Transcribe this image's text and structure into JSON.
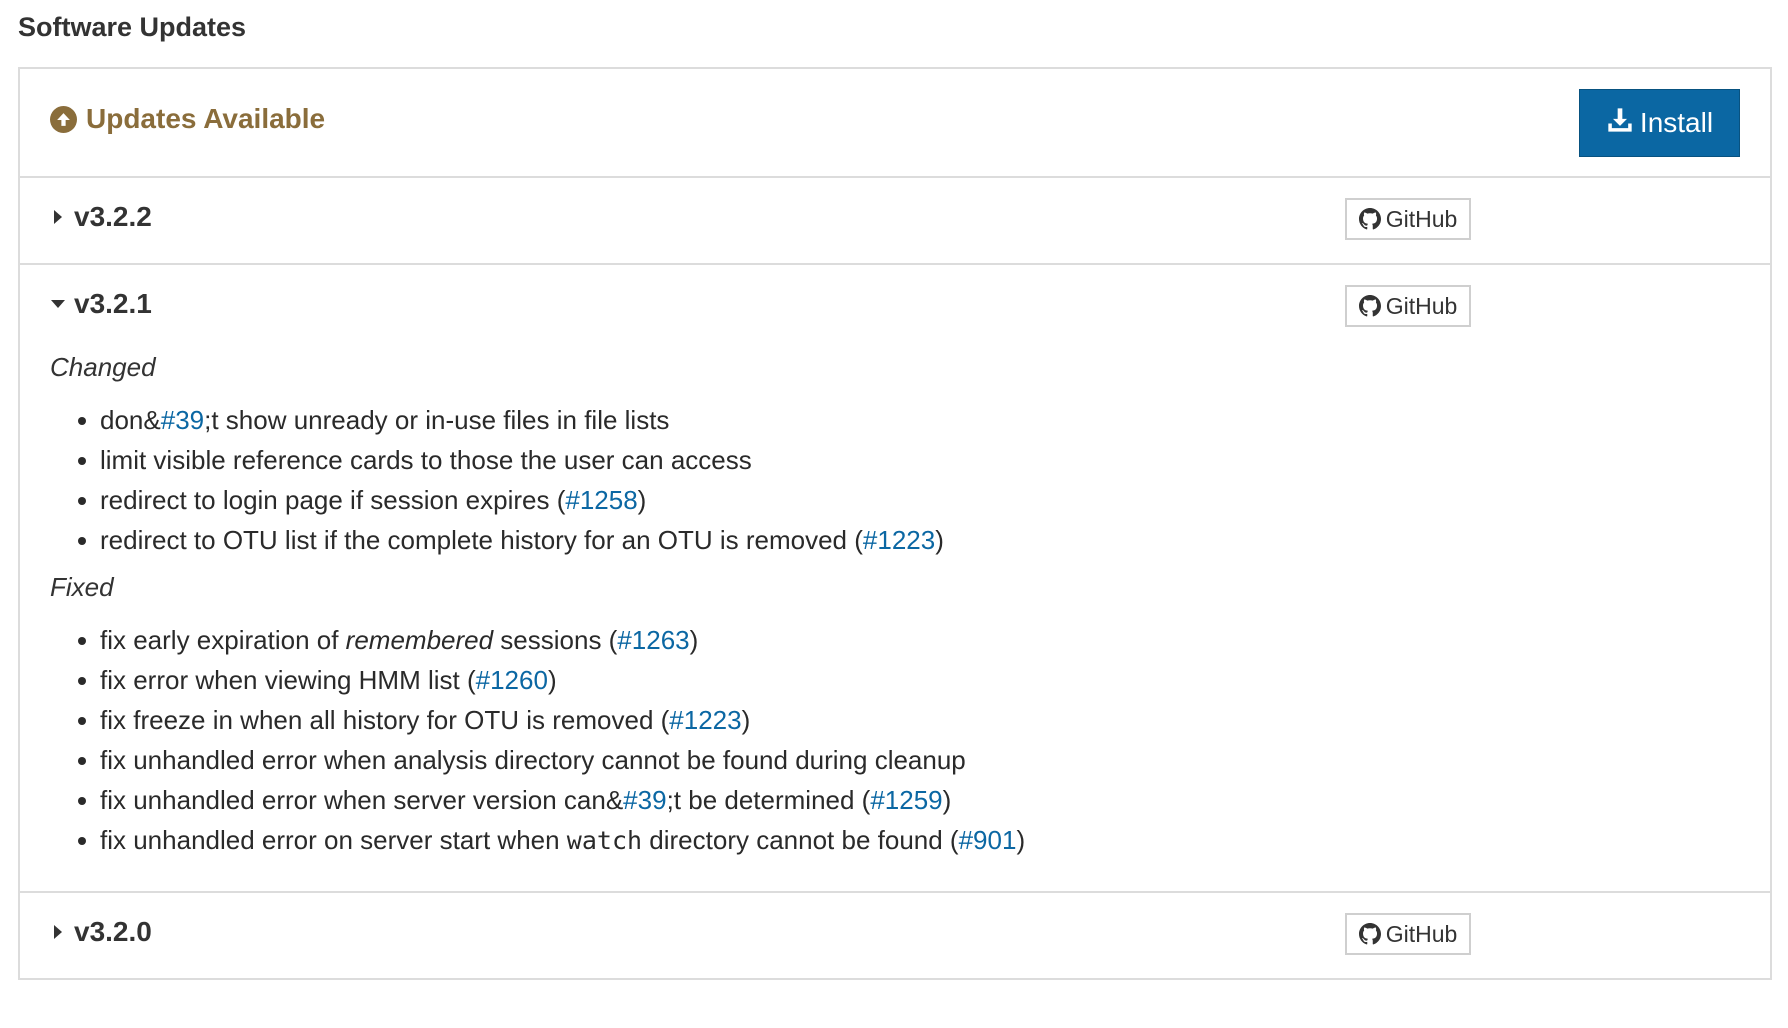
{
  "page": {
    "title": "Software Updates"
  },
  "header": {
    "status_label": "Updates Available",
    "install_label": "Install"
  },
  "releases": [
    {
      "version": "v3.2.2",
      "github_label": "GitHub",
      "expanded": false
    },
    {
      "version": "v3.2.1",
      "github_label": "GitHub",
      "expanded": true,
      "sections": [
        {
          "label": "Changed",
          "items": [
            {
              "parts": [
                {
                  "t": "don&"
                },
                {
                  "link": "#39"
                },
                {
                  "t": ";t show unready or in-use files in file lists"
                }
              ]
            },
            {
              "parts": [
                {
                  "t": "limit visible reference cards to those the user can access"
                }
              ]
            },
            {
              "parts": [
                {
                  "t": "redirect to login page if session expires ("
                },
                {
                  "link": "#1258"
                },
                {
                  "t": ")"
                }
              ]
            },
            {
              "parts": [
                {
                  "t": "redirect to OTU list if the complete history for an OTU is removed ("
                },
                {
                  "link": "#1223"
                },
                {
                  "t": ")"
                }
              ]
            }
          ]
        },
        {
          "label": "Fixed",
          "items": [
            {
              "parts": [
                {
                  "t": "fix early expiration of "
                },
                {
                  "em": "remembered"
                },
                {
                  "t": " sessions ("
                },
                {
                  "link": "#1263"
                },
                {
                  "t": ")"
                }
              ]
            },
            {
              "parts": [
                {
                  "t": "fix error when viewing HMM list ("
                },
                {
                  "link": "#1260"
                },
                {
                  "t": ")"
                }
              ]
            },
            {
              "parts": [
                {
                  "t": "fix freeze in when all history for OTU is removed ("
                },
                {
                  "link": "#1223"
                },
                {
                  "t": ")"
                }
              ]
            },
            {
              "parts": [
                {
                  "t": "fix unhandled error when analysis directory cannot be found during cleanup"
                }
              ]
            },
            {
              "parts": [
                {
                  "t": "fix unhandled error when server version can&"
                },
                {
                  "link": "#39"
                },
                {
                  "t": ";t be determined ("
                },
                {
                  "link": "#1259"
                },
                {
                  "t": ")"
                }
              ]
            },
            {
              "parts": [
                {
                  "t": "fix unhandled error on server start when "
                },
                {
                  "code": "watch"
                },
                {
                  "t": " directory cannot be found ("
                },
                {
                  "link": "#901"
                },
                {
                  "t": ")"
                }
              ]
            }
          ]
        }
      ]
    },
    {
      "version": "v3.2.0",
      "github_label": "GitHub",
      "expanded": false
    }
  ],
  "icons": {
    "status": "arrow-circle-up-icon",
    "install": "download-icon",
    "github": "github-icon",
    "collapsed": "caret-right-icon",
    "expanded": "caret-down-icon"
  },
  "colors": {
    "accent": "#0b67a3",
    "warning": "#8a6d3b",
    "link": "#0b67a3"
  }
}
